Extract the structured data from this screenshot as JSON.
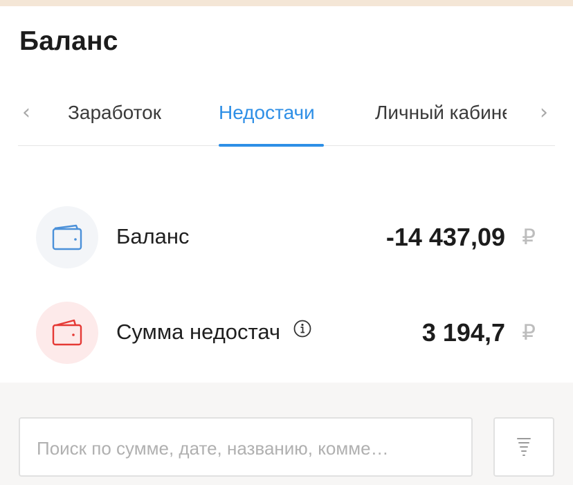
{
  "header": {
    "title": "Баланс"
  },
  "tabs": [
    {
      "label": "Заработок",
      "active": false
    },
    {
      "label": "Недостачи",
      "active": true
    },
    {
      "label": "Личный кабинет",
      "active": false
    }
  ],
  "balance_rows": [
    {
      "label": "Баланс",
      "value": "-14 437,09",
      "currency": "₽",
      "icon": "wallet-icon"
    },
    {
      "label": "Сумма недостач",
      "value": "3 194,7",
      "currency": "₽",
      "icon": "wallet-icon",
      "info_icon": "info-icon"
    }
  ],
  "search": {
    "placeholder": "Поиск по сумме, дате, названию, комме…"
  },
  "colors": {
    "accent": "#2e8fe6",
    "warning": "#e53935",
    "top_strip": "#f4e6d6"
  }
}
